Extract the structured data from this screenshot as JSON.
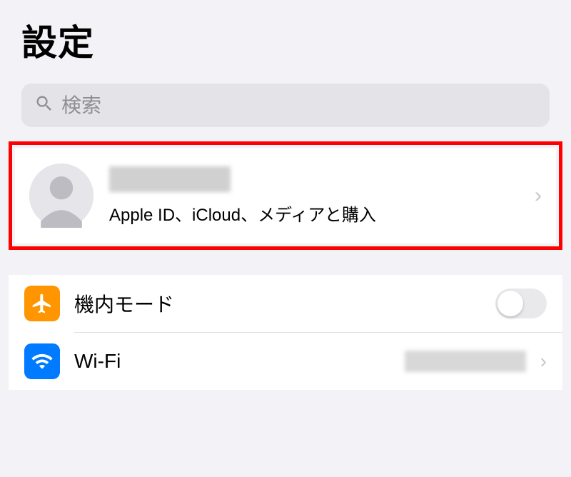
{
  "header": {
    "title": "設定"
  },
  "search": {
    "placeholder": "検索"
  },
  "apple_id": {
    "subtitle": "Apple ID、iCloud、メディアと購入"
  },
  "rows": {
    "airplane": {
      "label": "機内モード",
      "toggle_on": false
    },
    "wifi": {
      "label": "Wi-Fi"
    }
  },
  "colors": {
    "accent_orange": "#ff9500",
    "accent_blue": "#007aff",
    "highlight_red": "#ff0000"
  }
}
